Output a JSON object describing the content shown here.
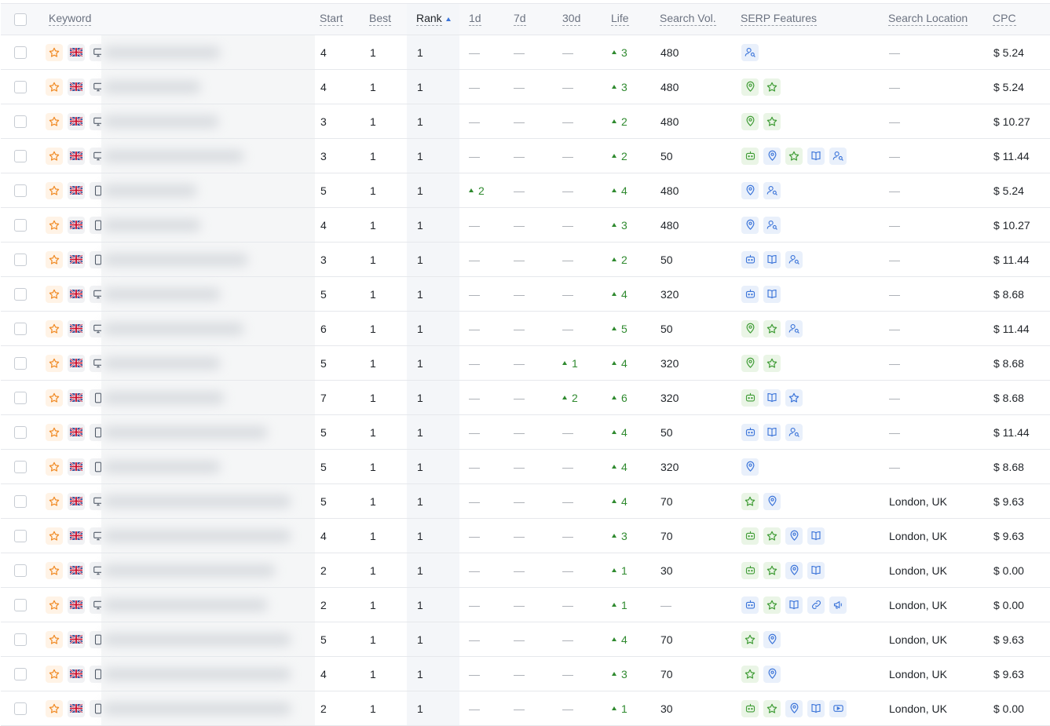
{
  "headers": {
    "keyword": "Keyword",
    "start": "Start",
    "best": "Best",
    "rank": "Rank",
    "d1": "1d",
    "d7": "7d",
    "d30": "30d",
    "life": "Life",
    "search_vol": "Search Vol.",
    "serp": "SERP Features",
    "location": "Search Location",
    "cpc": "CPC"
  },
  "sort": {
    "column": "rank",
    "direction": "ascending"
  },
  "colors": {
    "green": "#2f8a2f",
    "serp_green": "#3f9c35",
    "serp_blue": "#3b74d9",
    "star_orange": "#f08a24"
  },
  "rows": [
    {
      "start": "4",
      "best": "1",
      "rank": "1",
      "d1": "—",
      "d7": "—",
      "d30": "—",
      "life": "3",
      "vol": "480",
      "serp": [
        "people-also-ask-icon"
      ],
      "location": "—",
      "cpc": "$ 5.24",
      "device": "desktop-icon"
    },
    {
      "start": "4",
      "best": "1",
      "rank": "1",
      "d1": "—",
      "d7": "—",
      "d30": "—",
      "life": "3",
      "vol": "480",
      "serp": [
        "local-pack-icon",
        "reviews-icon"
      ],
      "location": "—",
      "cpc": "$ 5.24",
      "device": "desktop-icon"
    },
    {
      "start": "3",
      "best": "1",
      "rank": "1",
      "d1": "—",
      "d7": "—",
      "d30": "—",
      "life": "2",
      "vol": "480",
      "serp": [
        "local-pack-icon",
        "reviews-icon"
      ],
      "location": "—",
      "cpc": "$ 10.27",
      "device": "desktop-icon"
    },
    {
      "start": "3",
      "best": "1",
      "rank": "1",
      "d1": "—",
      "d7": "—",
      "d30": "—",
      "life": "2",
      "vol": "50",
      "serp": [
        "ai-overview-icon",
        "local-pack-icon",
        "reviews-icon",
        "knowledge-panel-icon",
        "people-also-ask-icon"
      ],
      "location": "—",
      "cpc": "$ 11.44",
      "device": "desktop-icon"
    },
    {
      "start": "5",
      "best": "1",
      "rank": "1",
      "d1": "2",
      "d7": "—",
      "d30": "—",
      "life": "4",
      "vol": "480",
      "serp": [
        "local-pack-icon",
        "people-also-ask-icon"
      ],
      "location": "—",
      "cpc": "$ 5.24",
      "device": "mobile-icon"
    },
    {
      "start": "4",
      "best": "1",
      "rank": "1",
      "d1": "—",
      "d7": "—",
      "d30": "—",
      "life": "3",
      "vol": "480",
      "serp": [
        "local-pack-icon",
        "people-also-ask-icon"
      ],
      "location": "—",
      "cpc": "$ 10.27",
      "device": "mobile-icon"
    },
    {
      "start": "3",
      "best": "1",
      "rank": "1",
      "d1": "—",
      "d7": "—",
      "d30": "—",
      "life": "2",
      "vol": "50",
      "serp": [
        "ai-overview-icon",
        "knowledge-panel-icon",
        "people-also-ask-icon"
      ],
      "location": "—",
      "cpc": "$ 11.44",
      "device": "mobile-icon"
    },
    {
      "start": "5",
      "best": "1",
      "rank": "1",
      "d1": "—",
      "d7": "—",
      "d30": "—",
      "life": "4",
      "vol": "320",
      "serp": [
        "ai-overview-icon",
        "knowledge-panel-icon"
      ],
      "location": "—",
      "cpc": "$ 8.68",
      "device": "desktop-icon"
    },
    {
      "start": "6",
      "best": "1",
      "rank": "1",
      "d1": "—",
      "d7": "—",
      "d30": "—",
      "life": "5",
      "vol": "50",
      "serp": [
        "local-pack-icon",
        "reviews-icon",
        "people-also-ask-icon"
      ],
      "location": "—",
      "cpc": "$ 11.44",
      "device": "desktop-icon"
    },
    {
      "start": "5",
      "best": "1",
      "rank": "1",
      "d1": "—",
      "d7": "—",
      "d30": "1",
      "life": "4",
      "vol": "320",
      "serp": [
        "local-pack-icon",
        "reviews-icon"
      ],
      "location": "—",
      "cpc": "$ 8.68",
      "device": "desktop-icon"
    },
    {
      "start": "7",
      "best": "1",
      "rank": "1",
      "d1": "—",
      "d7": "—",
      "d30": "2",
      "life": "6",
      "vol": "320",
      "serp": [
        "ai-overview-icon",
        "knowledge-panel-icon",
        "reviews-icon"
      ],
      "location": "—",
      "cpc": "$ 8.68",
      "device": "mobile-icon"
    },
    {
      "start": "5",
      "best": "1",
      "rank": "1",
      "d1": "—",
      "d7": "—",
      "d30": "—",
      "life": "4",
      "vol": "50",
      "serp": [
        "ai-overview-icon",
        "knowledge-panel-icon",
        "people-also-ask-icon"
      ],
      "location": "—",
      "cpc": "$ 11.44",
      "device": "mobile-icon"
    },
    {
      "start": "5",
      "best": "1",
      "rank": "1",
      "d1": "—",
      "d7": "—",
      "d30": "—",
      "life": "4",
      "vol": "320",
      "serp": [
        "local-pack-icon"
      ],
      "location": "—",
      "cpc": "$ 8.68",
      "device": "mobile-icon"
    },
    {
      "start": "5",
      "best": "1",
      "rank": "1",
      "d1": "—",
      "d7": "—",
      "d30": "—",
      "life": "4",
      "vol": "70",
      "serp": [
        "reviews-icon",
        "local-pack-icon"
      ],
      "location": "London, UK",
      "cpc": "$ 9.63",
      "device": "desktop-icon"
    },
    {
      "start": "4",
      "best": "1",
      "rank": "1",
      "d1": "—",
      "d7": "—",
      "d30": "—",
      "life": "3",
      "vol": "70",
      "serp": [
        "ai-overview-icon",
        "reviews-icon",
        "local-pack-icon",
        "knowledge-panel-icon"
      ],
      "location": "London, UK",
      "cpc": "$ 9.63",
      "device": "desktop-icon"
    },
    {
      "start": "2",
      "best": "1",
      "rank": "1",
      "d1": "—",
      "d7": "—",
      "d30": "—",
      "life": "1",
      "vol": "30",
      "serp": [
        "ai-overview-icon",
        "reviews-icon",
        "local-pack-icon",
        "knowledge-panel-icon"
      ],
      "location": "London, UK",
      "cpc": "$ 0.00",
      "device": "desktop-icon"
    },
    {
      "start": "2",
      "best": "1",
      "rank": "1",
      "d1": "—",
      "d7": "—",
      "d30": "—",
      "life": "1",
      "vol": "—",
      "serp": [
        "ai-overview-icon",
        "reviews-icon",
        "knowledge-panel-icon",
        "sitelinks-icon",
        "ads-icon"
      ],
      "location": "London, UK",
      "cpc": "$ 0.00",
      "device": "desktop-icon"
    },
    {
      "start": "5",
      "best": "1",
      "rank": "1",
      "d1": "—",
      "d7": "—",
      "d30": "—",
      "life": "4",
      "vol": "70",
      "serp": [
        "reviews-icon",
        "local-pack-icon"
      ],
      "location": "London, UK",
      "cpc": "$ 9.63",
      "device": "mobile-icon"
    },
    {
      "start": "4",
      "best": "1",
      "rank": "1",
      "d1": "—",
      "d7": "—",
      "d30": "—",
      "life": "3",
      "vol": "70",
      "serp": [
        "reviews-icon",
        "local-pack-icon"
      ],
      "location": "London, UK",
      "cpc": "$ 9.63",
      "device": "mobile-icon"
    },
    {
      "start": "2",
      "best": "1",
      "rank": "1",
      "d1": "—",
      "d7": "—",
      "d30": "—",
      "life": "1",
      "vol": "30",
      "serp": [
        "ai-overview-icon",
        "reviews-icon",
        "local-pack-icon",
        "knowledge-panel-icon",
        "video-icon"
      ],
      "location": "London, UK",
      "cpc": "$ 0.00",
      "device": "mobile-icon"
    }
  ]
}
